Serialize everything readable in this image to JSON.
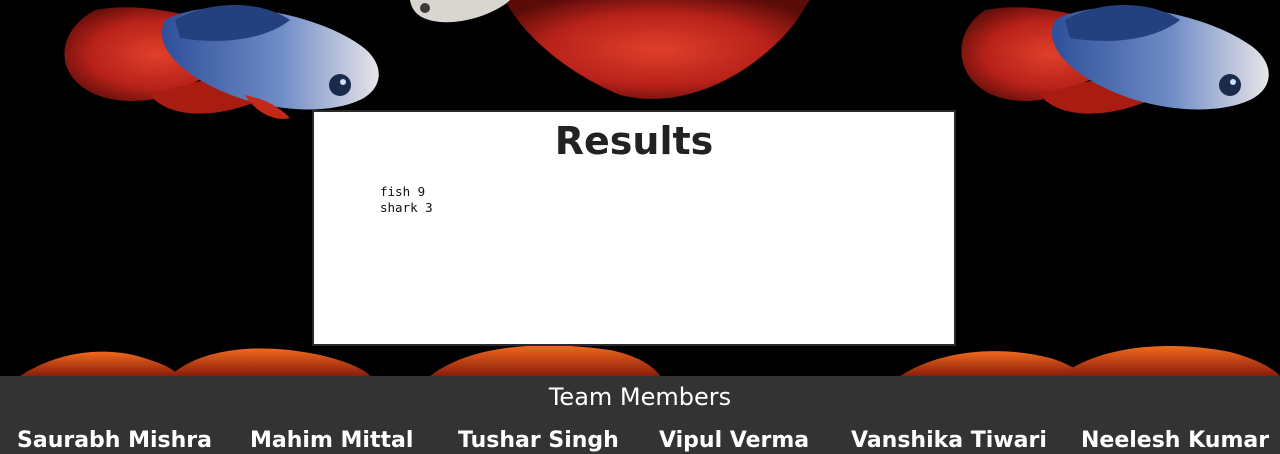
{
  "results": {
    "title": "Results",
    "lines": [
      "fish 9",
      "shark 3"
    ]
  },
  "footer": {
    "title": "Team Members",
    "members": [
      "Saurabh Mishra",
      "Mahim Mittal",
      "Tushar Singh",
      "Vipul Verma",
      "Vanshika Tiwari",
      "Neelesh Kumar"
    ]
  },
  "colors": {
    "background": "#000000",
    "fish_red": "#c8281c",
    "fish_blue": "#2c4f92",
    "card": "#ffffff",
    "footer": "#333333"
  }
}
